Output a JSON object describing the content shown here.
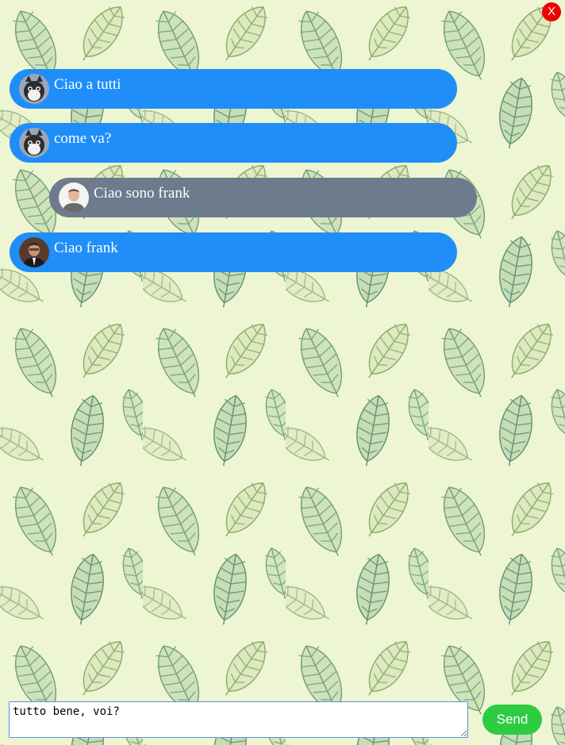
{
  "window": {
    "close_label": "X"
  },
  "messages": [
    {
      "sender": "other",
      "avatar": "cat-avatar",
      "text": "Ciao a tutti"
    },
    {
      "sender": "other",
      "avatar": "cat-avatar",
      "text": "come va?"
    },
    {
      "sender": "self",
      "avatar": "man-gray-shirt-avatar",
      "text": "Ciao sono frank"
    },
    {
      "sender": "other",
      "avatar": "man-suit-avatar",
      "text": "Ciao frank"
    }
  ],
  "composer": {
    "value": "tutto bene, voi?",
    "send_label": "Send"
  },
  "colors": {
    "incoming_bubble": "#1f8ef8",
    "outgoing_bubble": "#6e7b8c",
    "send_button": "#2ecc40",
    "close_button": "#ee0000",
    "background": "#eef5d2"
  }
}
